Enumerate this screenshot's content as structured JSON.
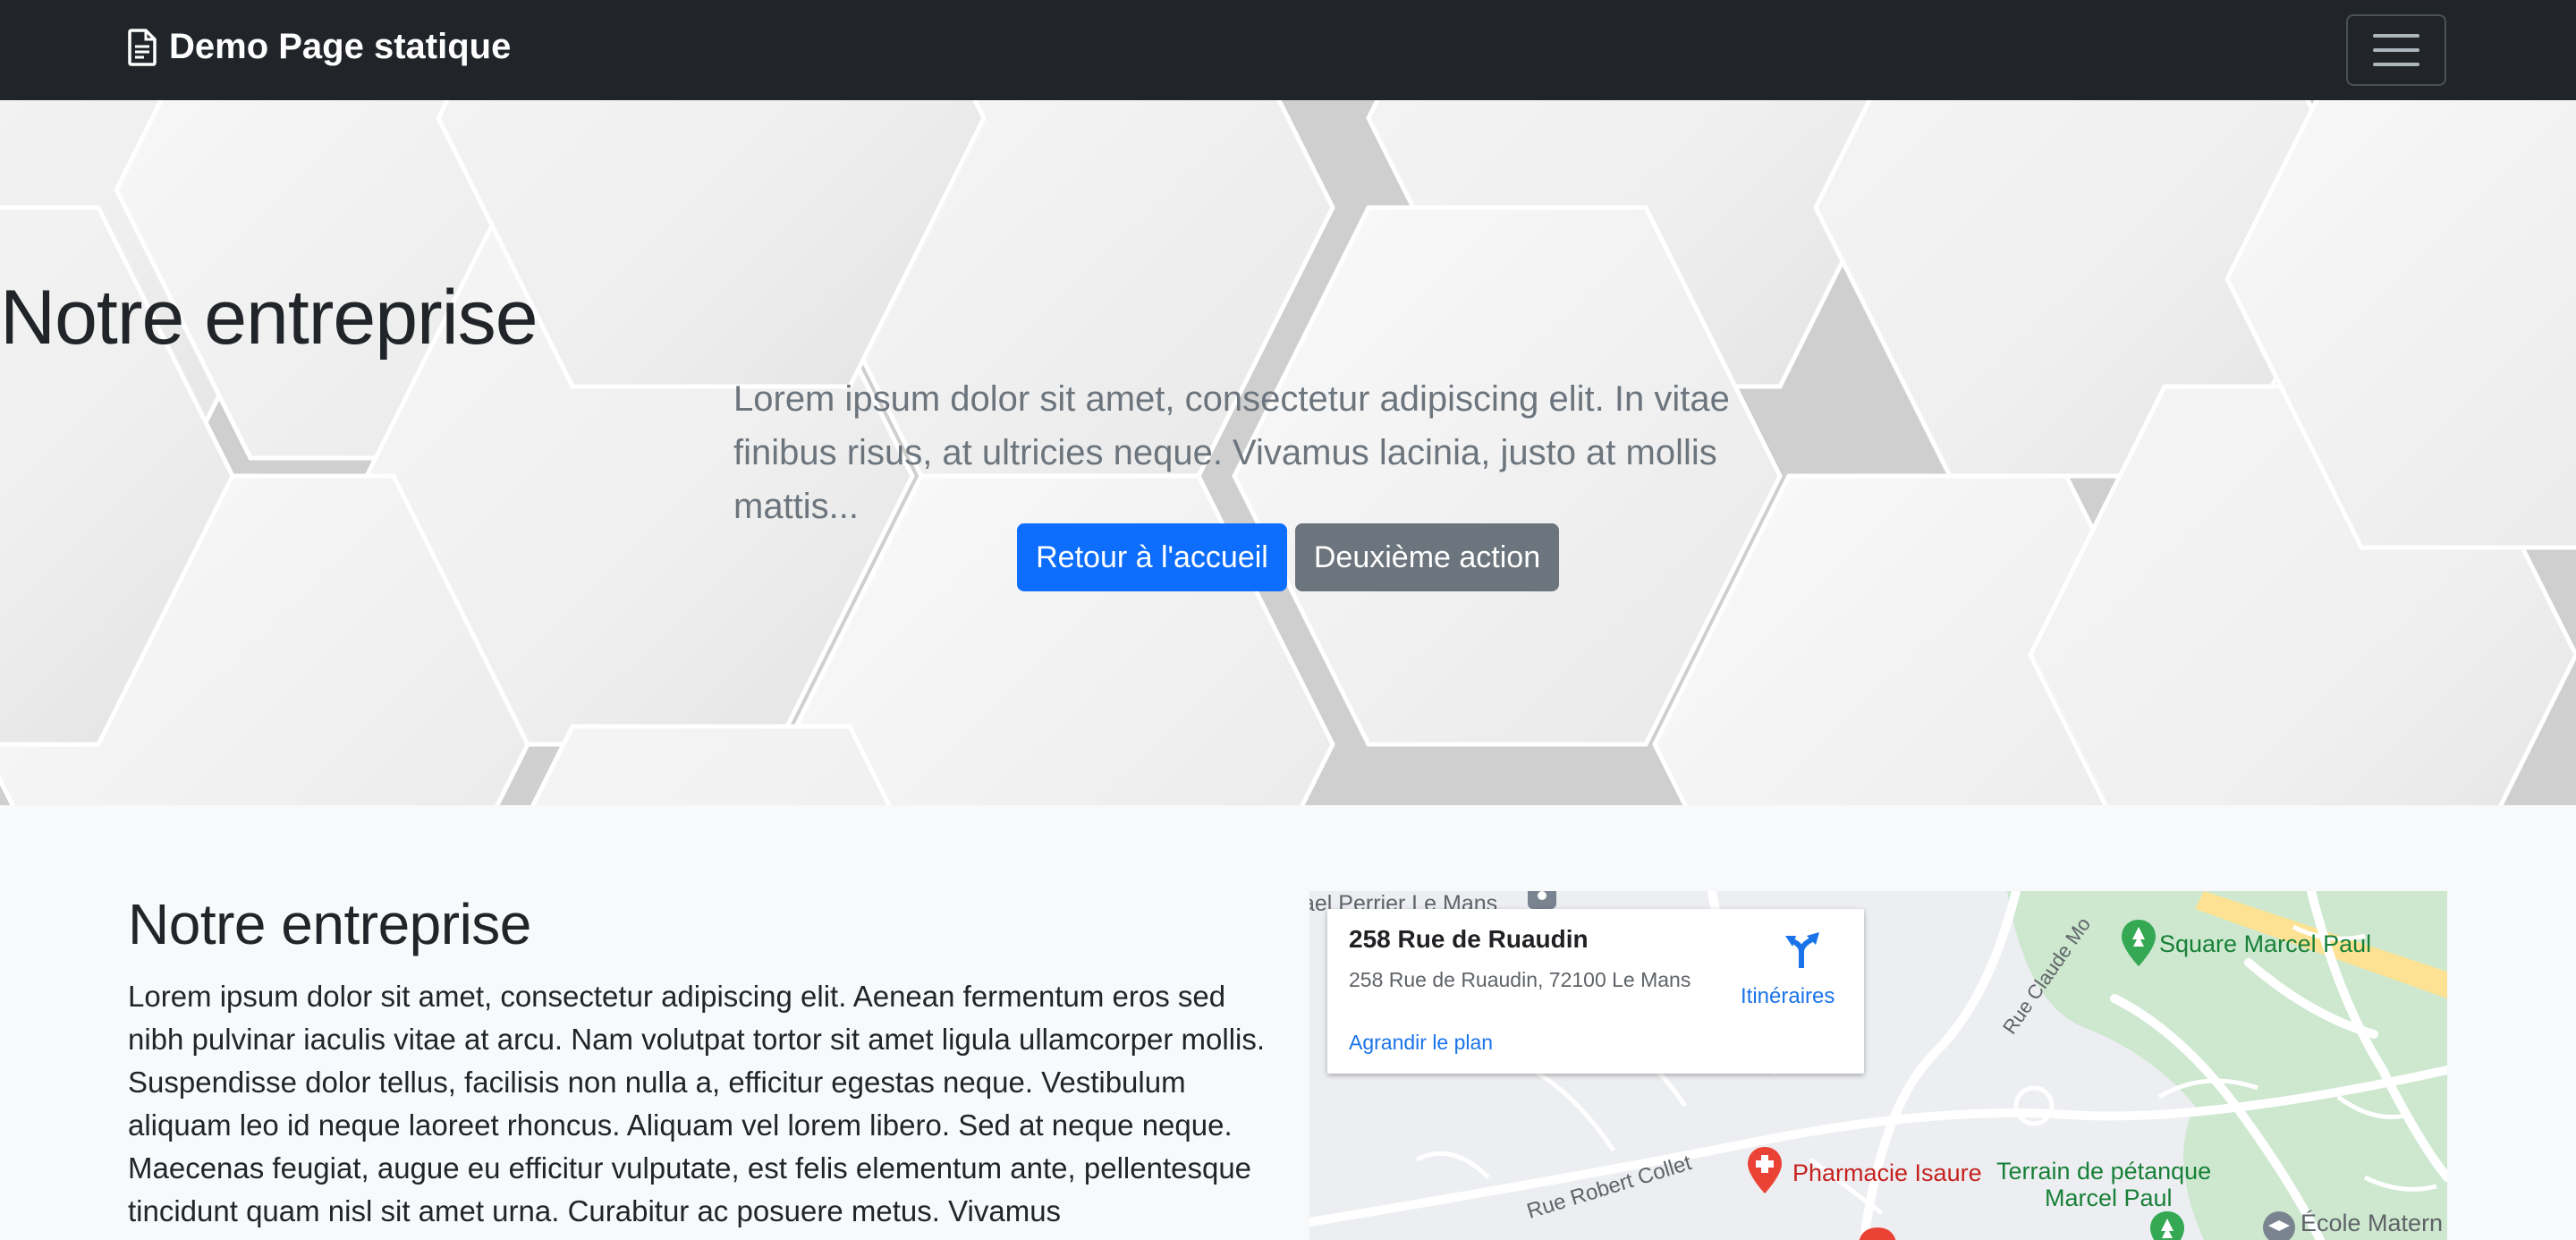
{
  "navbar": {
    "brand": "Demo Page statique",
    "brand_icon": "file-text-icon",
    "toggler_icon": "hamburger-menu-icon"
  },
  "hero": {
    "title": "Notre entreprise",
    "lead": "Lorem ipsum dolor sit amet, consectetur adipiscing elit. In vitae finibus risus, at ultricies neque. Vivamus lacinia, justo at mollis mattis...",
    "primary_button": "Retour à l'accueil",
    "secondary_button": "Deuxième action"
  },
  "section": {
    "title": "Notre entreprise",
    "text": "Lorem ipsum dolor sit amet, consectetur adipiscing elit. Aenean fermentum eros sed nibh pulvinar iaculis vitae at arcu. Nam volutpat tortor sit amet ligula ullamcorper mollis. Suspendisse dolor tellus, facilisis non nulla a, efficitur egestas neque. Vestibulum aliquam leo id neque laoreet rhoncus. Aliquam vel lorem libero. Sed at neque neque. Maecenas feugiat, augue eu efficitur vulputate, est felis elementum ante, pellentesque tincidunt quam nisl sit amet urna. Curabitur ac posuere metus. Vivamus"
  },
  "map": {
    "card": {
      "title": "258 Rue de Ruaudin",
      "address": "258 Rue de Ruaudin, 72100 Le Mans",
      "directions": "Itinéraires",
      "enlarge": "Agrandir le plan"
    },
    "labels": {
      "top_left": "ael Perrier Le Mans",
      "park": "Square Marcel Paul",
      "pharmacy": "Pharmacie Isaure",
      "petanque_1": "Terrain de pétanque",
      "petanque_2": "Marcel Paul",
      "school": "École Matern",
      "street_collet": "Rue Robert Collet",
      "street_claude": "Rue Claude Mo"
    },
    "colors": {
      "park": "#c8e6c9",
      "road_major": "#fde293",
      "label_green": "#188038",
      "label_red": "#c5221f",
      "link_blue": "#1a73e8"
    }
  },
  "colors": {
    "navbar": "#212529",
    "primary": "#0d6efd",
    "secondary": "#6c757d"
  }
}
